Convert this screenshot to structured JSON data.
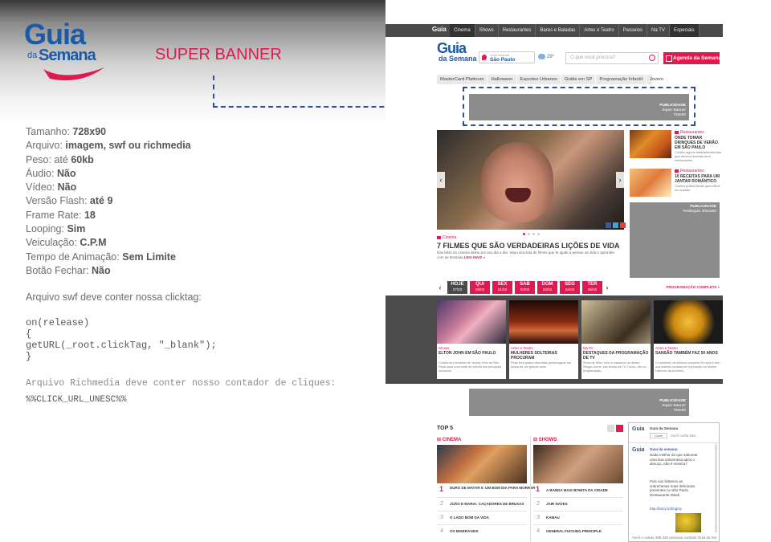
{
  "logo": {
    "word1": "Guia",
    "word2": "da",
    "word3": "Semana"
  },
  "banner_title": "SUPER BANNER",
  "specs": [
    {
      "label": "Tamanho:",
      "value": "728x90"
    },
    {
      "label": "Arquivo:",
      "value": "imagem, swf ou richmedia"
    },
    {
      "label": "Peso: até",
      "value": "60kb"
    },
    {
      "label": "Áudio:",
      "value": "Não"
    },
    {
      "label": "Vídeo:",
      "value": "Não"
    },
    {
      "label": "Versão Flash:",
      "value": "até 9"
    },
    {
      "label": "Frame Rate:",
      "value": "18"
    },
    {
      "label": "Looping:",
      "value": "Sim"
    },
    {
      "label": "Veiculação:",
      "value": "C.P.M"
    },
    {
      "label": "Tempo de Animação:",
      "value": "Sem Limite"
    },
    {
      "label": "Botão Fechar:",
      "value": "Não"
    }
  ],
  "clicktag_note": "Arquivo swf deve conter nossa clicktag:",
  "code": "on(release)\n{\ngetURL(_root.clickTag, \"_blank\");\n}",
  "richmedia_note": "Arquivo Richmedia deve conter nosso contador de cliques:",
  "click_url": "%%CLICK_URL_UNESC%%",
  "site": {
    "nav_logo": "Guia",
    "nav_items": [
      "Cinema",
      "Shows",
      "Restaurantes",
      "Bares e Baladas",
      "Artes e Teatro",
      "Passeios",
      "Na TV",
      "Especiais"
    ],
    "header_logo_top": "Guia",
    "header_logo_bottom": "da Semana",
    "location_small": "Você está em",
    "location_city": "São Paulo",
    "weather": "29°",
    "search_placeholder": "O que você procura?",
    "agenda_button": "Agenda da Semana",
    "tags": [
      "MasterCard Platinum",
      "Halloween",
      "Esportes Urbanos",
      "Grátis em SP",
      "Programação Infantil",
      "Jovem"
    ],
    "super_banner_ad": {
      "line1": "PUBLICIDADE",
      "line2": "Super Banner",
      "line3": "728x90"
    },
    "retangulo_ad": {
      "line1": "PUBLICIDADE",
      "line2": "Retângulo 300x250"
    },
    "hero": {
      "category": "Cinema",
      "title": "7 FILMES QUE SÃO VERDADEIRAS LIÇÕES DE VIDA",
      "desc": "Das telas do cinema direto pro seu dia a dia. Veja uma lista de filmes que te ajude a pensar na vida e aprender com as histórias",
      "more": "LEIA MAIS »"
    },
    "side_items": [
      {
        "category": "Restaurantes",
        "title": "ONDE TOMAR DRINQUES DE VERÃO EM SÃO PAULO",
        "desc": "Confira alguns estabelecimentos que servem bebidas bem refrescantes"
      },
      {
        "category": "Restaurantes",
        "title": "10 RECEITAS PARA UM JANTAR ROMÂNTICO",
        "desc": "Confira pratos ideais para servir na ocasião"
      }
    ],
    "days": [
      {
        "name": "HOJE",
        "date": "27/03"
      },
      {
        "name": "QUI",
        "date": "28/02"
      },
      {
        "name": "SEX",
        "date": "01/03"
      },
      {
        "name": "SAB",
        "date": "02/03"
      },
      {
        "name": "DOM",
        "date": "03/03"
      },
      {
        "name": "SEG",
        "date": "04/03"
      },
      {
        "name": "TER",
        "date": "05/03"
      }
    ],
    "prog_link": "PROGRAMAÇÃO COMPLETA »",
    "cards": [
      {
        "category": "Shows",
        "title": "ELTON JOHN EM SÃO PAULO",
        "desc": "Confira as previsões de Jockey Club de São Paulo para uma noite de estreia dos principais sucessos"
      },
      {
        "category": "Artes e Teatro",
        "title": "MULHERES SOLTEIRAS PROCURAM",
        "desc": "Peça leva quatro divertidas personagens em busca de um grande amor"
      },
      {
        "category": "Na TV",
        "title": "DESTAQUES DA PROGRAMAÇÃO DE TV",
        "desc": "Show de Elton John e clássicos do diretor Sérgio Leone, são temas da TV Cocos, não só programação"
      },
      {
        "category": "Artes e Teatro",
        "title": "SANSÃO TAMBÉM FAZ 50 ANOS",
        "desc": "O coelhinho da Mônica completa 50 anos e tem sua história contada em exposição no Museu Histórico da América"
      }
    ],
    "bottom_ad": {
      "line1": "PUBLICIDADE",
      "line2": "Super Banner",
      "line3": "728x90"
    },
    "top5": {
      "title": "TOP 5",
      "cinema_label": "CINEMA",
      "shows_label": "SHOWS",
      "cinema": [
        "DURO DE MATAR 5: UM BOM DIA PARA MORRER",
        "JOÃO E MARIA: CAÇADORES DE BRUXAS",
        "O LADO BOM DA VIDA",
        "OS MISERÁVEIS"
      ],
      "shows": [
        "A BANDA MAIS BONITA DA CIDADE",
        "JAIR NAVES",
        "KAMAU",
        "GENERAL FUCKING PRINCIPLE"
      ],
      "ranks": [
        "1",
        "2",
        "3",
        "4"
      ]
    },
    "twitter": {
      "name": "Guia da Semana",
      "follow": "Curtir",
      "follow_count": "Você curtiu isso.",
      "tweet1_author": "Guia da semana",
      "tweet1_text": "Nada melhor do que saborear uma boa sobremesa após o almoço, não é mesmo?",
      "tweet2_text": "Pois nós listamos as sobremesas mais deliciosas presentes no São Paulo Restaurante Week",
      "tweet2_link": "http://bit.ly/12fmgGy",
      "footer": "Você e outras 485.348 pessoas curtiram Guia da Semana"
    }
  }
}
